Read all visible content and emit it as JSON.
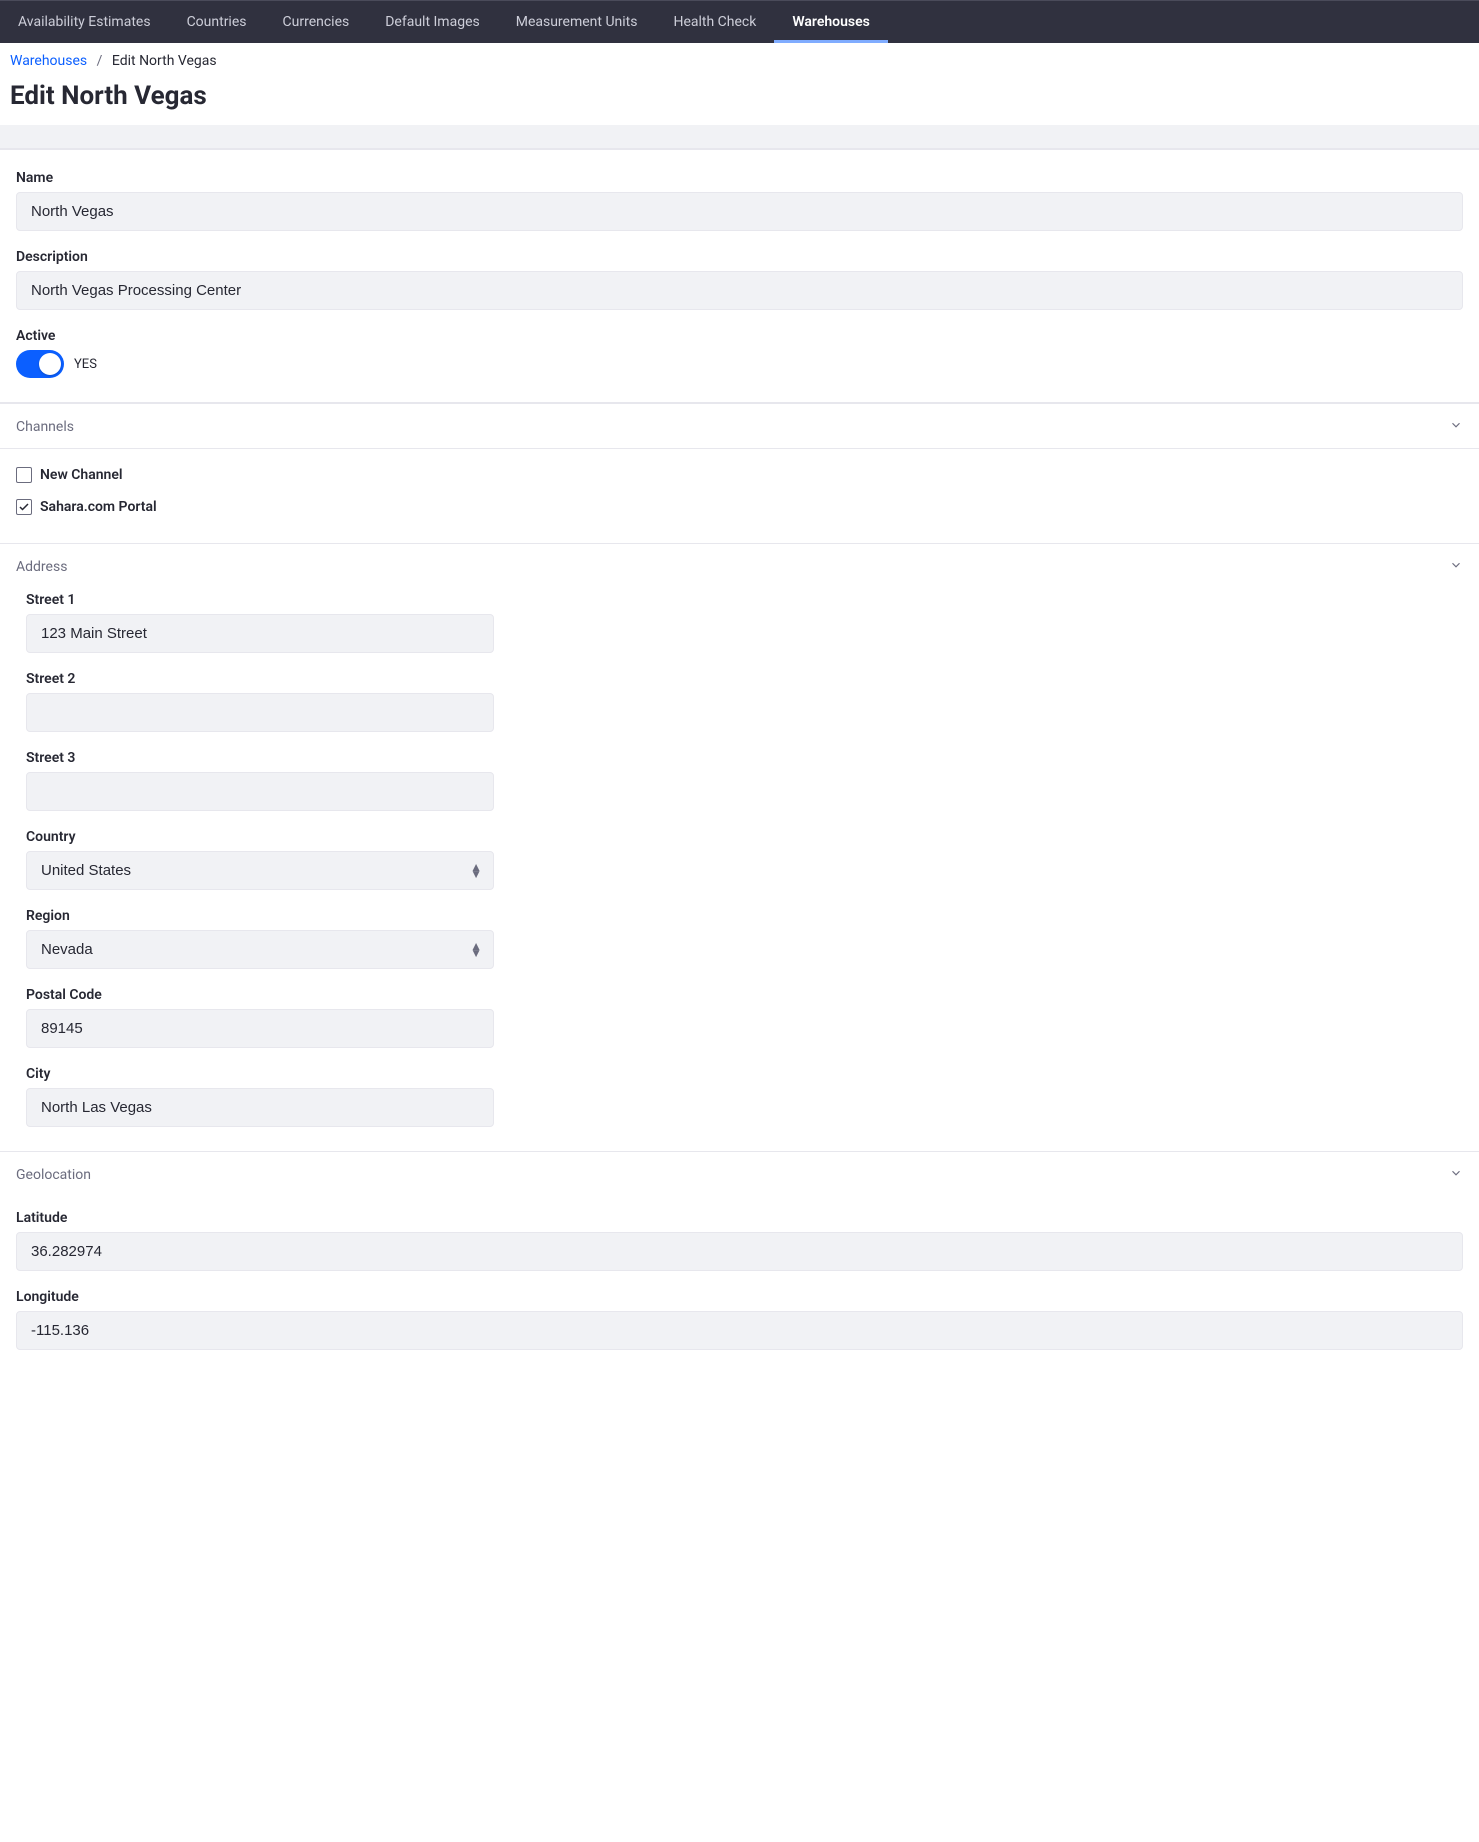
{
  "topbar": {
    "items": [
      {
        "label": "Availability Estimates",
        "active": false
      },
      {
        "label": "Countries",
        "active": false
      },
      {
        "label": "Currencies",
        "active": false
      },
      {
        "label": "Default Images",
        "active": false
      },
      {
        "label": "Measurement Units",
        "active": false
      },
      {
        "label": "Health Check",
        "active": false
      },
      {
        "label": "Warehouses",
        "active": true
      }
    ]
  },
  "breadcrumb": {
    "root": "Warehouses",
    "current": "Edit North Vegas"
  },
  "page_title": "Edit North Vegas",
  "form": {
    "name_label": "Name",
    "name_value": "North Vegas",
    "description_label": "Description",
    "description_value": "North Vegas Processing Center",
    "active_label": "Active",
    "active_value_text": "YES"
  },
  "channels": {
    "title": "Channels",
    "items": [
      {
        "label": "New Channel",
        "checked": false
      },
      {
        "label": "Sahara.com Portal",
        "checked": true
      }
    ]
  },
  "address": {
    "title": "Address",
    "street1_label": "Street 1",
    "street1_value": "123 Main Street",
    "street2_label": "Street 2",
    "street2_value": "",
    "street3_label": "Street 3",
    "street3_value": "",
    "country_label": "Country",
    "country_value": "United States",
    "region_label": "Region",
    "region_value": "Nevada",
    "postal_label": "Postal Code",
    "postal_value": "89145",
    "city_label": "City",
    "city_value": "North Las Vegas"
  },
  "geolocation": {
    "title": "Geolocation",
    "latitude_label": "Latitude",
    "latitude_value": "36.282974",
    "longitude_label": "Longitude",
    "longitude_value": "-115.136"
  }
}
